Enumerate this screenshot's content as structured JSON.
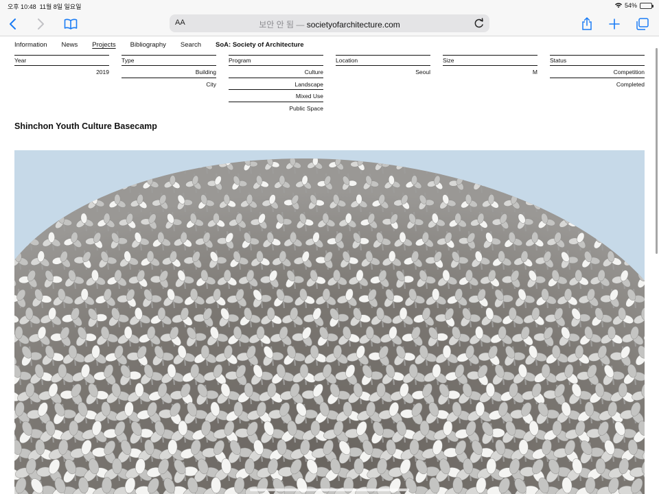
{
  "status_bar": {
    "time": "오후 10:48",
    "date": "11월 8일 일요일",
    "battery_text": "54%",
    "battery_level": 0.54
  },
  "browser": {
    "aa_label": "AA",
    "url_insecure_label": "보안 안 됨 —",
    "url_domain": "societyofarchitecture.com"
  },
  "nav": {
    "items": [
      "Information",
      "News",
      "Projects",
      "Bibliography",
      "Search"
    ],
    "active": "Projects",
    "brand": "SoA: Society of Architecture"
  },
  "filters": [
    {
      "label": "Year",
      "values": [
        "2019"
      ]
    },
    {
      "label": "Type",
      "values": [
        "Building",
        "City"
      ]
    },
    {
      "label": "Program",
      "values": [
        "Culture",
        "Landscape",
        "Mixed Use",
        "Public Space"
      ]
    },
    {
      "label": "Location",
      "values": [
        "Seoul"
      ]
    },
    {
      "label": "Size",
      "values": [
        "M"
      ]
    },
    {
      "label": "Status",
      "values": [
        "Competition",
        "Completed"
      ]
    }
  ],
  "project": {
    "title": "Shinchon Youth Culture Basecamp"
  },
  "colors": {
    "sky": "#c9dbe9",
    "accent_link": "#1a7cf5",
    "battery_green": "#2fbf3a"
  }
}
